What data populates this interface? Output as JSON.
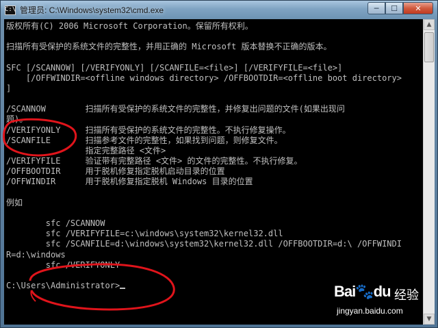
{
  "window": {
    "title": "管理员: C:\\Windows\\system32\\cmd.exe",
    "icon": "cmd-icon",
    "controls": {
      "minimize": "─",
      "maximize": "☐",
      "close": "✕"
    }
  },
  "console": {
    "lines": [
      "版权所有(C) 2006 Microsoft Corporation。保留所有权利。",
      "",
      "扫描所有受保护的系统文件的完整性，并用正确的 Microsoft 版本替换不正确的版本。",
      "",
      "SFC [/SCANNOW] [/VERIFYONLY] [/SCANFILE=<file>] [/VERIFYFILE=<file>]",
      "    [/OFFWINDIR=<offline windows directory> /OFFBOOTDIR=<offline boot directory>",
      "]",
      "",
      "/SCANNOW        扫描所有受保护的系统文件的完整性，并修复出问题的文件(如果出现问",
      "题)。",
      "/VERIFYONLY     扫描所有受保护的系统文件的完整性。不执行修复操作。",
      "/SCANFILE       扫描参考文件的完整性，如果找到问题，则修复文件。",
      "                指定完整路径 <文件>",
      "/VERIFYFILE     验证带有完整路径 <文件> 的文件的完整性。不执行修复。",
      "/OFFBOOTDIR     用于脱机修复指定脱机启动目录的位置",
      "/OFFWINDIR      用于脱机修复指定脱机 Windows 目录的位置",
      "",
      "例如",
      "",
      "        sfc /SCANNOW",
      "        sfc /VERIFYFILE=c:\\windows\\system32\\kernel32.dll",
      "        sfc /SCANFILE=d:\\windows\\system32\\kernel32.dll /OFFBOOTDIR=d:\\ /OFFWINDI",
      "R=d:\\windows",
      "        sfc /VERIFYONLY",
      "",
      "C:\\Users\\Administrator>"
    ]
  },
  "watermark": {
    "brand": "Bai",
    "brand_suffix": "du",
    "cn": "经验",
    "url": "jingyan.baidu.com"
  },
  "colors": {
    "console_bg": "#000000",
    "console_text": "#c0c0c0",
    "annotation": "#e0141b"
  }
}
